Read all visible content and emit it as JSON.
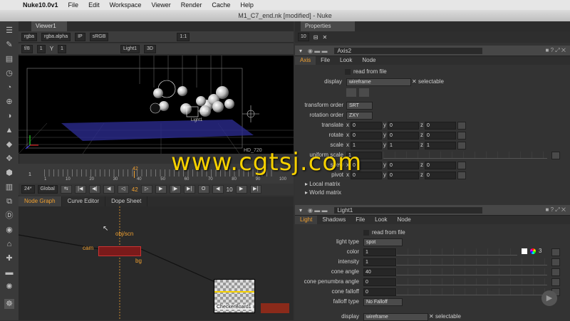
{
  "menubar": {
    "app": "Nuke10.0v1",
    "items": [
      "File",
      "Edit",
      "Workspace",
      "Viewer",
      "Render",
      "Cache",
      "Help"
    ]
  },
  "window_title": "M1_C7_end.nk [modified] - Nuke",
  "viewer": {
    "tab": "Viewer1",
    "channels": "rgba",
    "channel_alpha": "rgba.alpha",
    "ip": "IP",
    "colorspace": "sRGB",
    "zoom": "1:1",
    "fstop": "f/8",
    "gain": "1",
    "y_label": "Y",
    "gamma": "1",
    "camera": "Light1",
    "mode": "3D",
    "format": "HD_720",
    "viewport_label": "Light1"
  },
  "timeline": {
    "current_frame": "42",
    "ticks": [
      "1",
      "10",
      "20",
      "30",
      "40",
      "50",
      "60",
      "70",
      "80",
      "90",
      "100"
    ],
    "end_label": "100",
    "fps": "24*",
    "global": "Global",
    "frame_field": "42",
    "step": "10"
  },
  "watermark": "www.cgtsj.com",
  "nodegraph": {
    "tabs": [
      "Node Graph",
      "Curve Editor",
      "Dope Sheet"
    ],
    "labels": {
      "obj": "obj/scn",
      "cam": "cam",
      "bg": "bg",
      "checker": "CheckerBoard1"
    }
  },
  "properties": {
    "title": "Properties",
    "count": "10",
    "axis": {
      "name": "Axis2",
      "tabs": [
        "Axis",
        "File",
        "Look",
        "Node"
      ],
      "read_from_file": "read from file",
      "display_label": "display",
      "display": "wireframe",
      "selectable": "selectable",
      "transform_order_label": "transform order",
      "transform_order": "SRT",
      "rotation_order_label": "rotation order",
      "rotation_order": "ZXY",
      "rows": [
        {
          "label": "translate",
          "x": "0",
          "y": "0",
          "z": "0"
        },
        {
          "label": "rotate",
          "x": "0",
          "y": "0",
          "z": "0"
        },
        {
          "label": "scale",
          "x": "1",
          "y": "1",
          "z": "1"
        },
        {
          "label": "uniform scale",
          "x": "1",
          "y": "",
          "z": ""
        },
        {
          "label": "skew",
          "x": "0",
          "y": "0",
          "z": "0"
        },
        {
          "label": "pivot",
          "x": "0",
          "y": "0",
          "z": "0"
        }
      ],
      "local_matrix": "Local matrix",
      "world_matrix": "World matrix"
    },
    "light": {
      "name": "Light1",
      "tabs": [
        "Light",
        "Shadows",
        "File",
        "Look",
        "Node"
      ],
      "read_from_file": "read from file",
      "light_type_label": "light type",
      "light_type": "spot",
      "rows": [
        {
          "label": "color",
          "value": "1"
        },
        {
          "label": "intensity",
          "value": "1"
        },
        {
          "label": "cone angle",
          "value": "40"
        },
        {
          "label": "cone penumbra angle",
          "value": "0"
        },
        {
          "label": "cone falloff",
          "value": "0"
        }
      ],
      "color_channels": "3",
      "falloff_label": "falloff type",
      "falloff": "No Falloff",
      "display_label": "display",
      "display": "wireframe",
      "selectable": "selectable"
    }
  }
}
